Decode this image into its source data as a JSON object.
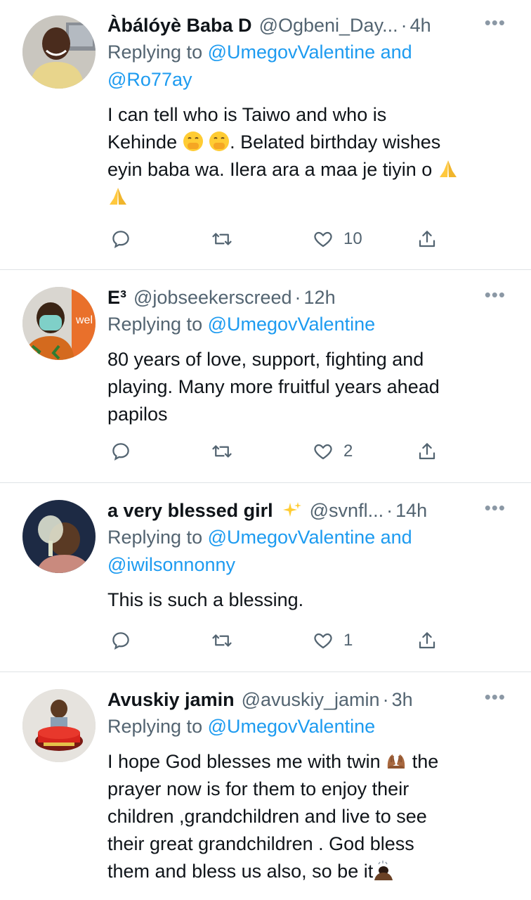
{
  "tweets": [
    {
      "name": "Àbálóyè Baba D",
      "handle": "@Ogbeni_Day...",
      "time": "4h",
      "replying_prefix": "Replying to ",
      "replying_to": "@UmegovValentine and",
      "replying_to_2": "@Ro77ay",
      "text_l1": "I can tell who is Taiwo and who is",
      "text_l2a": "Kehinde ",
      "text_l2b": ". Belated birthday wishes",
      "text_l3": "eyin baba wa. Ilera ara a maa je tiyin o ",
      "likes": "10"
    },
    {
      "name": "E³",
      "handle": "@jobseekerscreed",
      "time": "12h",
      "replying_prefix": "Replying to ",
      "replying_to": "@UmegovValentine",
      "text_l1": "80 years of love, support, fighting and",
      "text_l2": "playing. Many more fruitful years ahead",
      "text_l3": "papilos",
      "likes": "2"
    },
    {
      "name": "a very blessed girl",
      "handle": "@svnfl...",
      "time": "14h",
      "replying_prefix": "Replying to ",
      "replying_to": "@UmegovValentine and",
      "replying_to_2": "@iwilsonnonny",
      "text_l1": "This is such a blessing.",
      "likes": "1"
    },
    {
      "name": "Avuskiy jamin",
      "handle": "@avuskiy_jamin",
      "time": "3h",
      "replying_prefix": "Replying to ",
      "replying_to": "@UmegovValentine",
      "text_l1a": "I hope God blesses me with twin ",
      "text_l1b": " the",
      "text_l2": "prayer now is for them to enjoy their",
      "text_l3": "children ,grandchildren and live to see",
      "text_l4": "their great grandchildren . God bless",
      "text_l5": "them and bless us also, so be it"
    }
  ],
  "separator": "·",
  "more_icon": "•••",
  "colors": {
    "link": "#1d9bf0",
    "secondary": "#536471",
    "divider": "#dfe3e6"
  }
}
